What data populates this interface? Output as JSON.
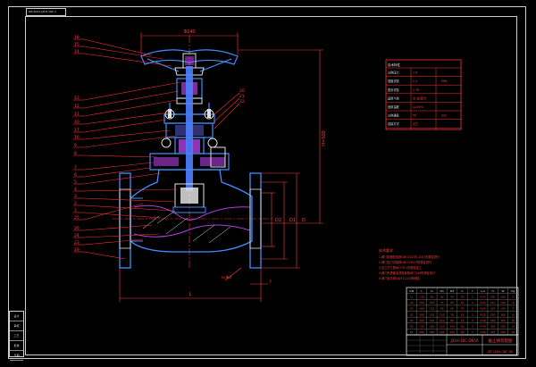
{
  "drawing_code": "DN·2021·J41H-16C·1",
  "part_callouts": [
    "18",
    "15",
    "14",
    "13",
    "12",
    "11",
    "10",
    "17",
    "16",
    "9",
    "8",
    "7",
    "6",
    "5",
    "4",
    "3",
    "2",
    "1",
    "25",
    "26",
    "24",
    "23",
    "19",
    "20",
    "21",
    "22"
  ],
  "dimensions": {
    "handwheel": "Φ240",
    "height": "H=500",
    "length": "L",
    "flange_d": "D",
    "flange_d1": "D1",
    "flange_d2": "D2",
    "bolt_holes": "n-Φd",
    "flange_thk": "b",
    "flange_f": "f"
  },
  "spec_table": {
    "title": "技术特性",
    "rows": [
      [
        "公称压力",
        "1.6",
        ""
      ],
      [
        "强度试验",
        "2.4",
        "MPa"
      ],
      [
        "密封试验",
        "1.76",
        ""
      ],
      [
        "适用介质",
        "水·油·蒸汽",
        ""
      ],
      [
        "适用温度",
        "≤200℃",
        ""
      ],
      [
        "公称通径",
        "50",
        "mm"
      ],
      [
        "连接方式",
        "法兰",
        ""
      ]
    ]
  },
  "notes": {
    "title": "技术要求",
    "lines": [
      "1.阀门制造检验按GB/T12235-2007的规定进行",
      "2.阀门压力试验按GB/T13927的规定进行",
      "3.法兰尺寸按JB/T79.1的规定加工",
      "4.阀门外表面涂漆颜色按JB/T106的规定执行",
      "5.阀门标志按GB/T12220的规定"
    ]
  },
  "dim_table": {
    "rows": [
      [
        "DN",
        "L",
        "D",
        "D1",
        "D2",
        "b",
        "f",
        "n-d",
        "H",
        "W",
        "Kg"
      ],
      [
        "15",
        "130",
        "95",
        "65",
        "45",
        "14",
        "2",
        "4-14",
        "200",
        "100",
        "3"
      ],
      [
        "20",
        "150",
        "105",
        "75",
        "55",
        "14",
        "2",
        "4-14",
        "210",
        "120",
        "4"
      ],
      [
        "25",
        "160",
        "115",
        "85",
        "65",
        "14",
        "2",
        "4-14",
        "225",
        "140",
        "5"
      ],
      [
        "32",
        "180",
        "135",
        "100",
        "78",
        "16",
        "2",
        "4-18",
        "250",
        "160",
        "8"
      ],
      [
        "40",
        "200",
        "145",
        "110",
        "85",
        "16",
        "3",
        "4-18",
        "265",
        "180",
        "10"
      ],
      [
        "50",
        "230",
        "160",
        "125",
        "100",
        "16",
        "3",
        "4-18",
        "285",
        "200",
        "13"
      ],
      [
        "65",
        "290",
        "180",
        "145",
        "120",
        "18",
        "3",
        "4-18",
        "325",
        "240",
        "19"
      ]
    ]
  },
  "title_block": {
    "title": "截止阀装配图",
    "company": "J41H-16C DN50",
    "drawing_no": "JZF·J41H-16C·00"
  },
  "left_strip": [
    "设计",
    "审核",
    "工艺",
    "批准",
    "日期"
  ],
  "colors": {
    "background": "#000000",
    "frame": "#cfcfcf",
    "outline": "#3f8fff",
    "section": "#e0e0e0",
    "leader": "#ff3030",
    "fill_purple": "#b040e0",
    "centerline": "#ff3030",
    "dimension": "#ff4040",
    "shaft": "#4a7fff"
  }
}
